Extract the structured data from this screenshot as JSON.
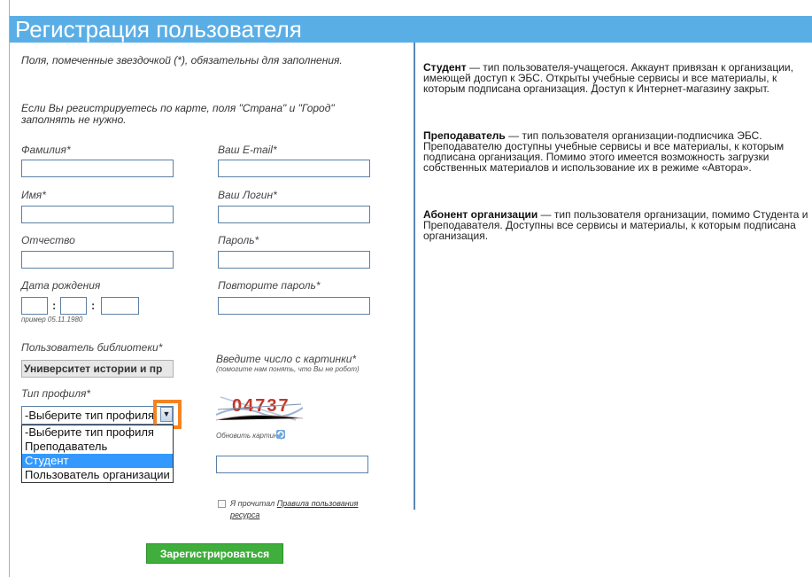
{
  "header": {
    "title": "Регистрация пользователя"
  },
  "notes": {
    "required": "Поля, помеченные звездочкой (*), обязательны для заполнения.",
    "card": "Если Вы регистрируетесь по карте, поля \"Страна\" и \"Город\" заполнять не нужно."
  },
  "fields": {
    "lastname": "Фамилия*",
    "email": "Ваш E-mail*",
    "firstname": "Имя*",
    "login": "Ваш Логин*",
    "patronymic": "Отчество",
    "password": "Пароль*",
    "birthdate": "Дата рождения",
    "birthdate_hint": "пример 05.11.1980",
    "password_repeat": "Повторите пароль*",
    "library_user": "Пользователь библиотеки*",
    "library_value": "Университет истории и пр",
    "captcha_label": "Введите число с картинки*",
    "captcha_hint": "(помогите нам понять, что Вы не робот)",
    "captcha_text": "04737",
    "refresh_captcha": "Обновить картинку",
    "profile_type": "Тип профиля*",
    "profile_selected": "-Выберите тип профиля"
  },
  "profile_options": [
    "-Выберите тип профиля",
    "Преподаватель",
    "Студент",
    "Пользователь организации"
  ],
  "agree": {
    "text": "Я прочитал",
    "link": "Правила пользования ресурса"
  },
  "submit_label": "Зарегистрироваться",
  "sidebar": {
    "student_title": "Студент",
    "student_text": " — тип пользователя-учащегося. Аккаунт привязан к организации, имеющей доступ к ЭБС. Открыты учебные сервисы и все материалы, к которым подписана организация. Доступ к Интернет-магазину закрыт.",
    "teacher_title": "Преподаватель",
    "teacher_text": " — тип пользователя организации-подписчика ЭБС. Преподавателю доступны учебные сервисы и все материалы, к которым подписана организация. Помимо этого имеется возможность загрузки собственных материалов и использование их в режиме «Автора».",
    "subscriber_title": "Абонент организации",
    "subscriber_text": " — тип пользователя организации, помимо Студента и Преподавателя. Доступны все сервисы и материалы, к которым подписана организация."
  },
  "colors": {
    "header": "#5aaee6",
    "submit": "#3fae3c",
    "highlight": "#f58220",
    "selected": "#3399ff"
  }
}
